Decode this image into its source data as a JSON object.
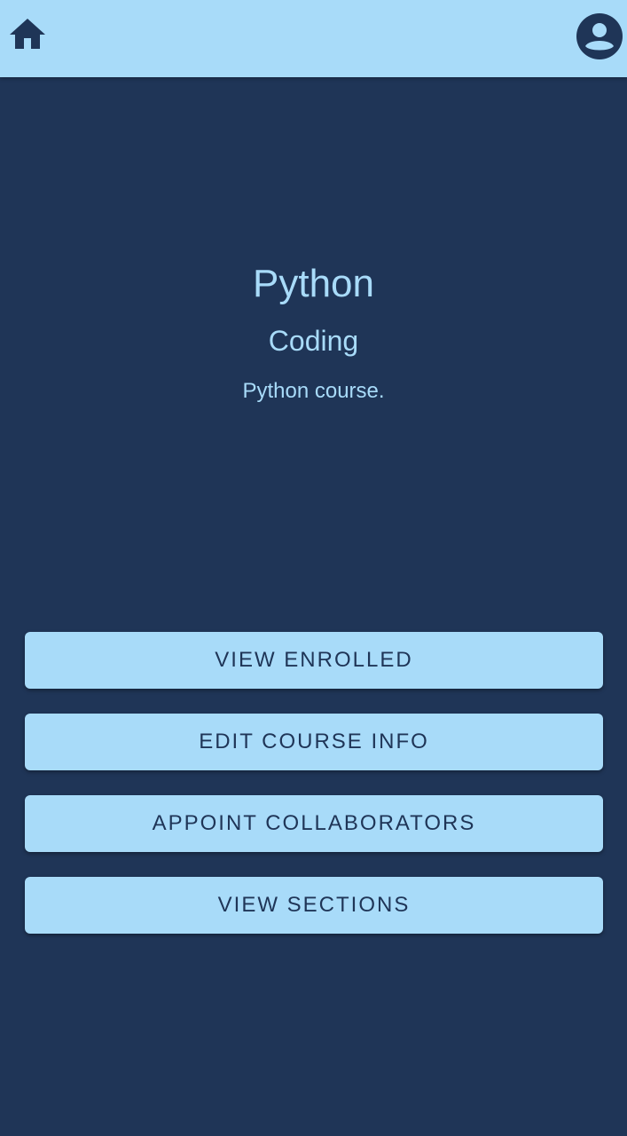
{
  "header": {
    "home_icon": "home-icon",
    "account_icon": "account-circle-icon",
    "background_color": "#a8dbf9",
    "icon_color": "#1f3557"
  },
  "course": {
    "title": "Python",
    "category": "Coding",
    "description": "Python course."
  },
  "actions": [
    {
      "label": "VIEW ENROLLED"
    },
    {
      "label": "EDIT COURSE INFO"
    },
    {
      "label": "APPOINT COLLABORATORS"
    },
    {
      "label": "VIEW SECTIONS"
    }
  ],
  "colors": {
    "background": "#1f3557",
    "accent": "#a8dbf9"
  }
}
